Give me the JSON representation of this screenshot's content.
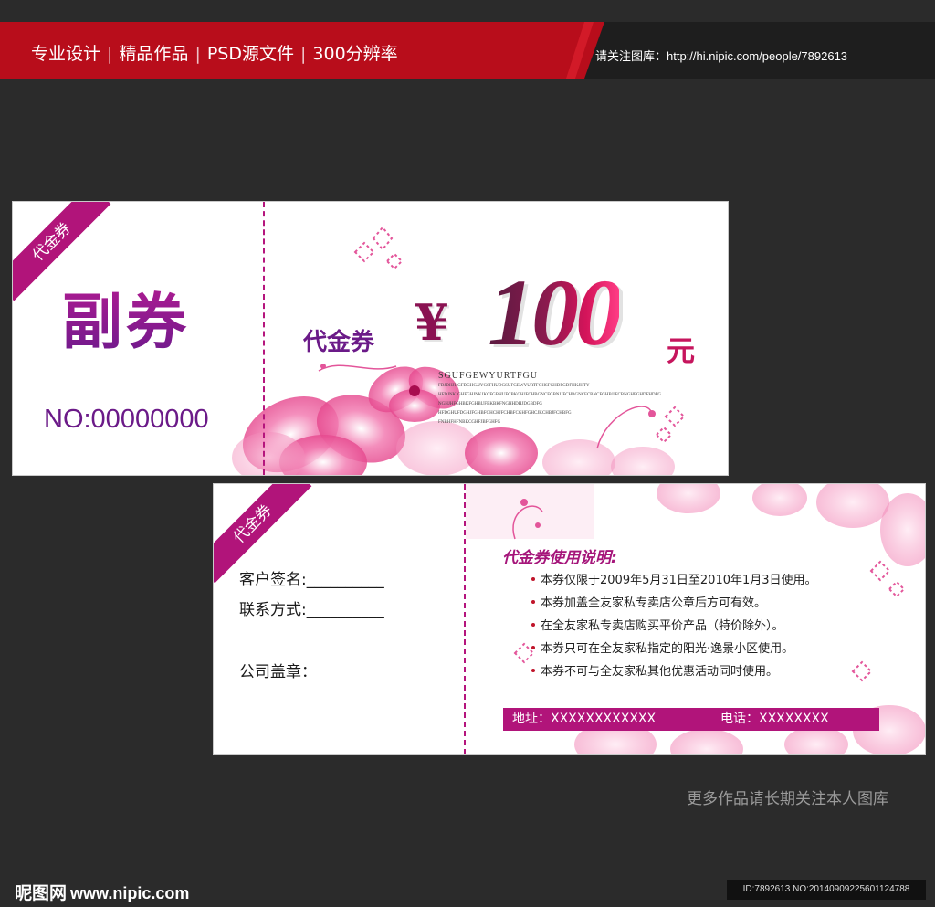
{
  "banner": {
    "tags": [
      "专业设计",
      "精品作品",
      "PSD源文件",
      "300分辨率"
    ],
    "follow_text": "请关注图库：http://hi.nipic.com/people/7892613"
  },
  "ticket1": {
    "ribbon": "代金券",
    "stub_title": "副券",
    "stub_no": "NO:00000000",
    "voucher_label": "代金券",
    "currency": "¥",
    "amount": "100",
    "unit": "元",
    "fine_title": "SGUFGEWYURTFGU",
    "fine_lines": [
      "FDJDHJHGFDGHGJJYGSFHUDGSUFGEWYURTFGHSFGHDFGDFHKJHTY",
      "HFDJNKJGHFGHJNKJKCFGBHUFCBKGHJFCHBGNCFGBNJJFCHBGNCFCBNCFGHBJJFCBNGHFGHDFHDFG",
      "NGHJHFGHBKFGHBUFBKBKFNGHHDHJDGBDFG",
      "HFDGHUFDGHJFGHBFGHCHJFCHBFCGHFGHCJKCHBJFCHBFG",
      "FNBHFHFNBKCGHFJBFGHFG"
    ]
  },
  "ticket2": {
    "ribbon": "代金券",
    "signature_label": "客户签名:__________",
    "contact_label": "联系方式:__________",
    "seal_label": "公司盖章：",
    "rules_title": "代金券使用说明:",
    "rules": [
      "本券仅限于2009年5月31日至2010年1月3日使用。",
      "本券加盖全友家私专卖店公章后方可有效。",
      "在全友家私专卖店购买平价产品（特价除外）。",
      "本券只可在全友家私指定的阳光·逸景小区使用。",
      "本券不可与全友家私其他优惠活动同时使用。"
    ],
    "address_label": "地址：XXXXXXXXXXXX",
    "phone_label": "电话：XXXXXXXX"
  },
  "footer": {
    "more_text": "更多作品请长期关注本人图库",
    "logo_text": "昵图网",
    "logo_url": "www.nipic.com",
    "id_line": "ID:7892613 NO:20140909225601124788"
  },
  "colors": {
    "background": "#2b2b2b",
    "banner_red": "#b80d1b",
    "accent_magenta": "#b1147a",
    "purple": "#6b1a88"
  }
}
